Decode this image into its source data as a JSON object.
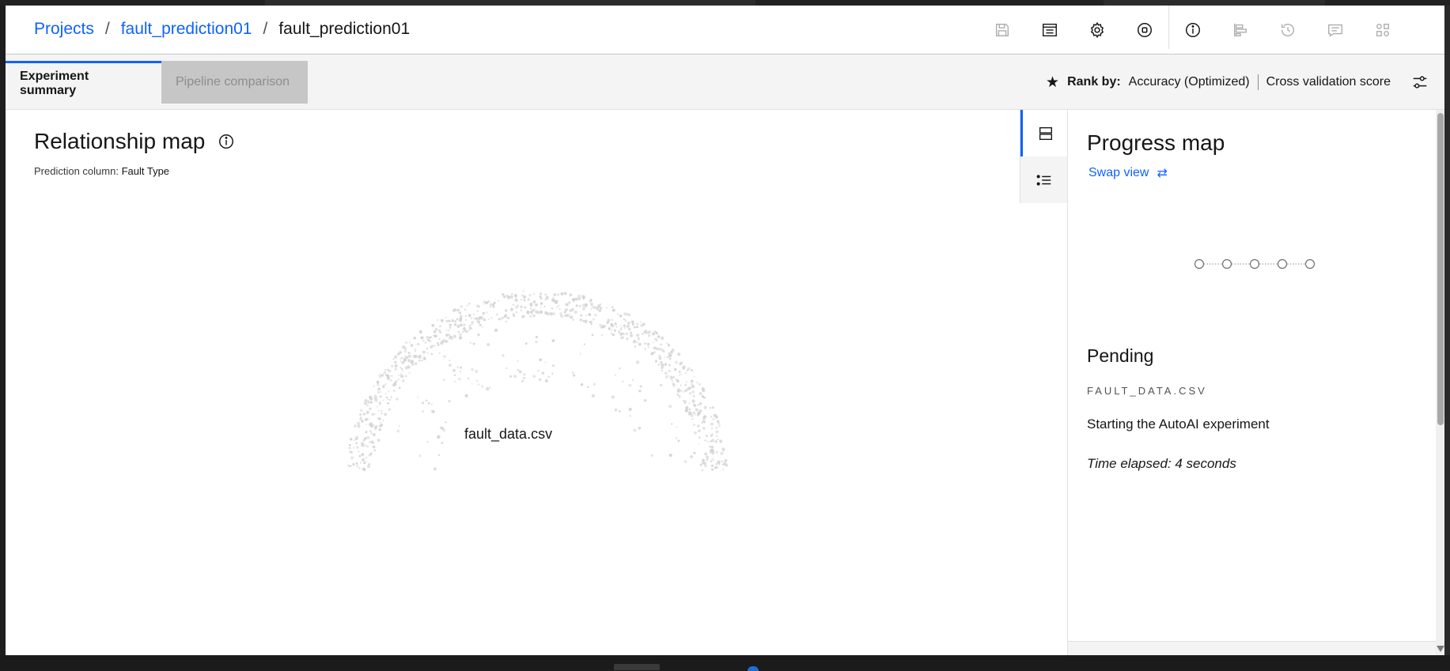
{
  "breadcrumb": {
    "projects": "Projects",
    "project": "fault_prediction01",
    "current": "fault_prediction01"
  },
  "toolbar": {
    "icons": [
      "save-icon",
      "notebook-icon",
      "settings-icon",
      "stop-icon",
      "info-icon",
      "pipeline-icon",
      "history-icon",
      "comments-icon",
      "apps-icon"
    ]
  },
  "tabs": {
    "experiment_summary": "Experiment summary",
    "pipeline_comparison": "Pipeline comparison"
  },
  "rank": {
    "label": "Rank by:",
    "metric": "Accuracy (Optimized)",
    "score": "Cross validation score"
  },
  "relationship": {
    "title": "Relationship map",
    "prediction_label": "Prediction column:",
    "prediction_value": "Fault Type",
    "center_label": "fault_data.csv"
  },
  "progress": {
    "title": "Progress map",
    "swap_view": "Swap view",
    "status": "Pending",
    "file": "FAULT_DATA.CSV",
    "message": "Starting the AutoAI experiment",
    "elapsed": "Time elapsed: 4 seconds",
    "nodes": 5
  },
  "colors": {
    "accent": "#0f62fe",
    "dots": "#d4d4d4"
  }
}
